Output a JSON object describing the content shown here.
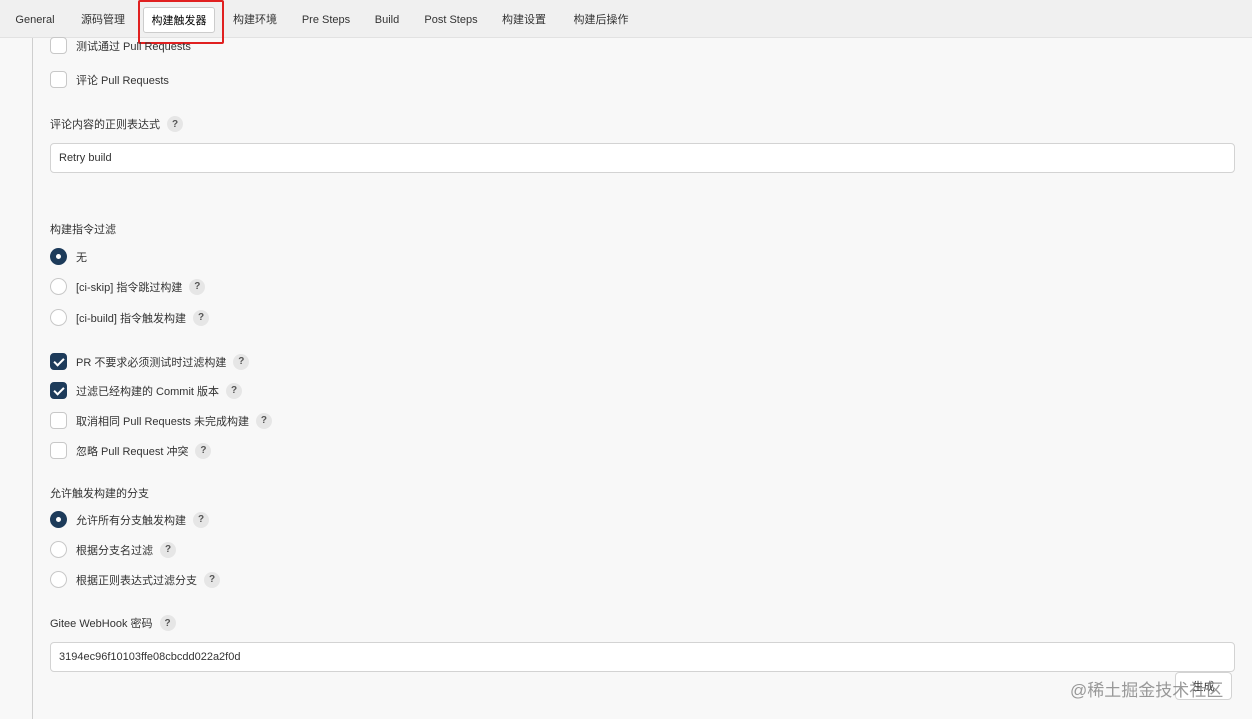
{
  "tabs": [
    {
      "label": "General"
    },
    {
      "label": "源码管理"
    },
    {
      "label": "构建触发器"
    },
    {
      "label": "构建环境"
    },
    {
      "label": "Pre Steps"
    },
    {
      "label": "Build"
    },
    {
      "label": "Post Steps"
    },
    {
      "label": "构建设置"
    },
    {
      "label": "构建后操作"
    }
  ],
  "active_tab": "构建触发器",
  "pr_options": [
    {
      "label": "测试通过 Pull Requests",
      "checked": false
    },
    {
      "label": "评论 Pull Requests",
      "checked": false
    }
  ],
  "comment_regex": {
    "label": "评论内容的正则表达式",
    "value": "Retry build"
  },
  "build_command_filter": {
    "label": "构建指令过滤",
    "options": [
      {
        "label": "无",
        "selected": true
      },
      {
        "label": "[ci-skip] 指令跳过构建",
        "selected": false
      },
      {
        "label": "[ci-build] 指令触发构建",
        "selected": false
      }
    ]
  },
  "filter_options": [
    {
      "label": "PR 不要求必须测试时过滤构建",
      "checked": true
    },
    {
      "label": "过滤已经构建的 Commit 版本",
      "checked": true
    },
    {
      "label": "取消相同 Pull Requests 未完成构建",
      "checked": false
    },
    {
      "label": "忽略 Pull Request 冲突",
      "checked": false
    }
  ],
  "branch_filter": {
    "label": "允许触发构建的分支",
    "options": [
      {
        "label": "允许所有分支触发构建",
        "selected": true
      },
      {
        "label": "根据分支名过滤",
        "selected": false
      },
      {
        "label": "根据正则表达式过滤分支",
        "selected": false
      }
    ]
  },
  "webhook": {
    "label": "Gitee WebHook 密码",
    "value": "3194ec96f10103ffe08cbcdd022a2f0d",
    "generate_label": "生成"
  },
  "help_glyph": "?",
  "watermark": "@稀土掘金技术社区",
  "colors": {
    "checked": "#1d3b5a",
    "highlight": "#e02020"
  }
}
